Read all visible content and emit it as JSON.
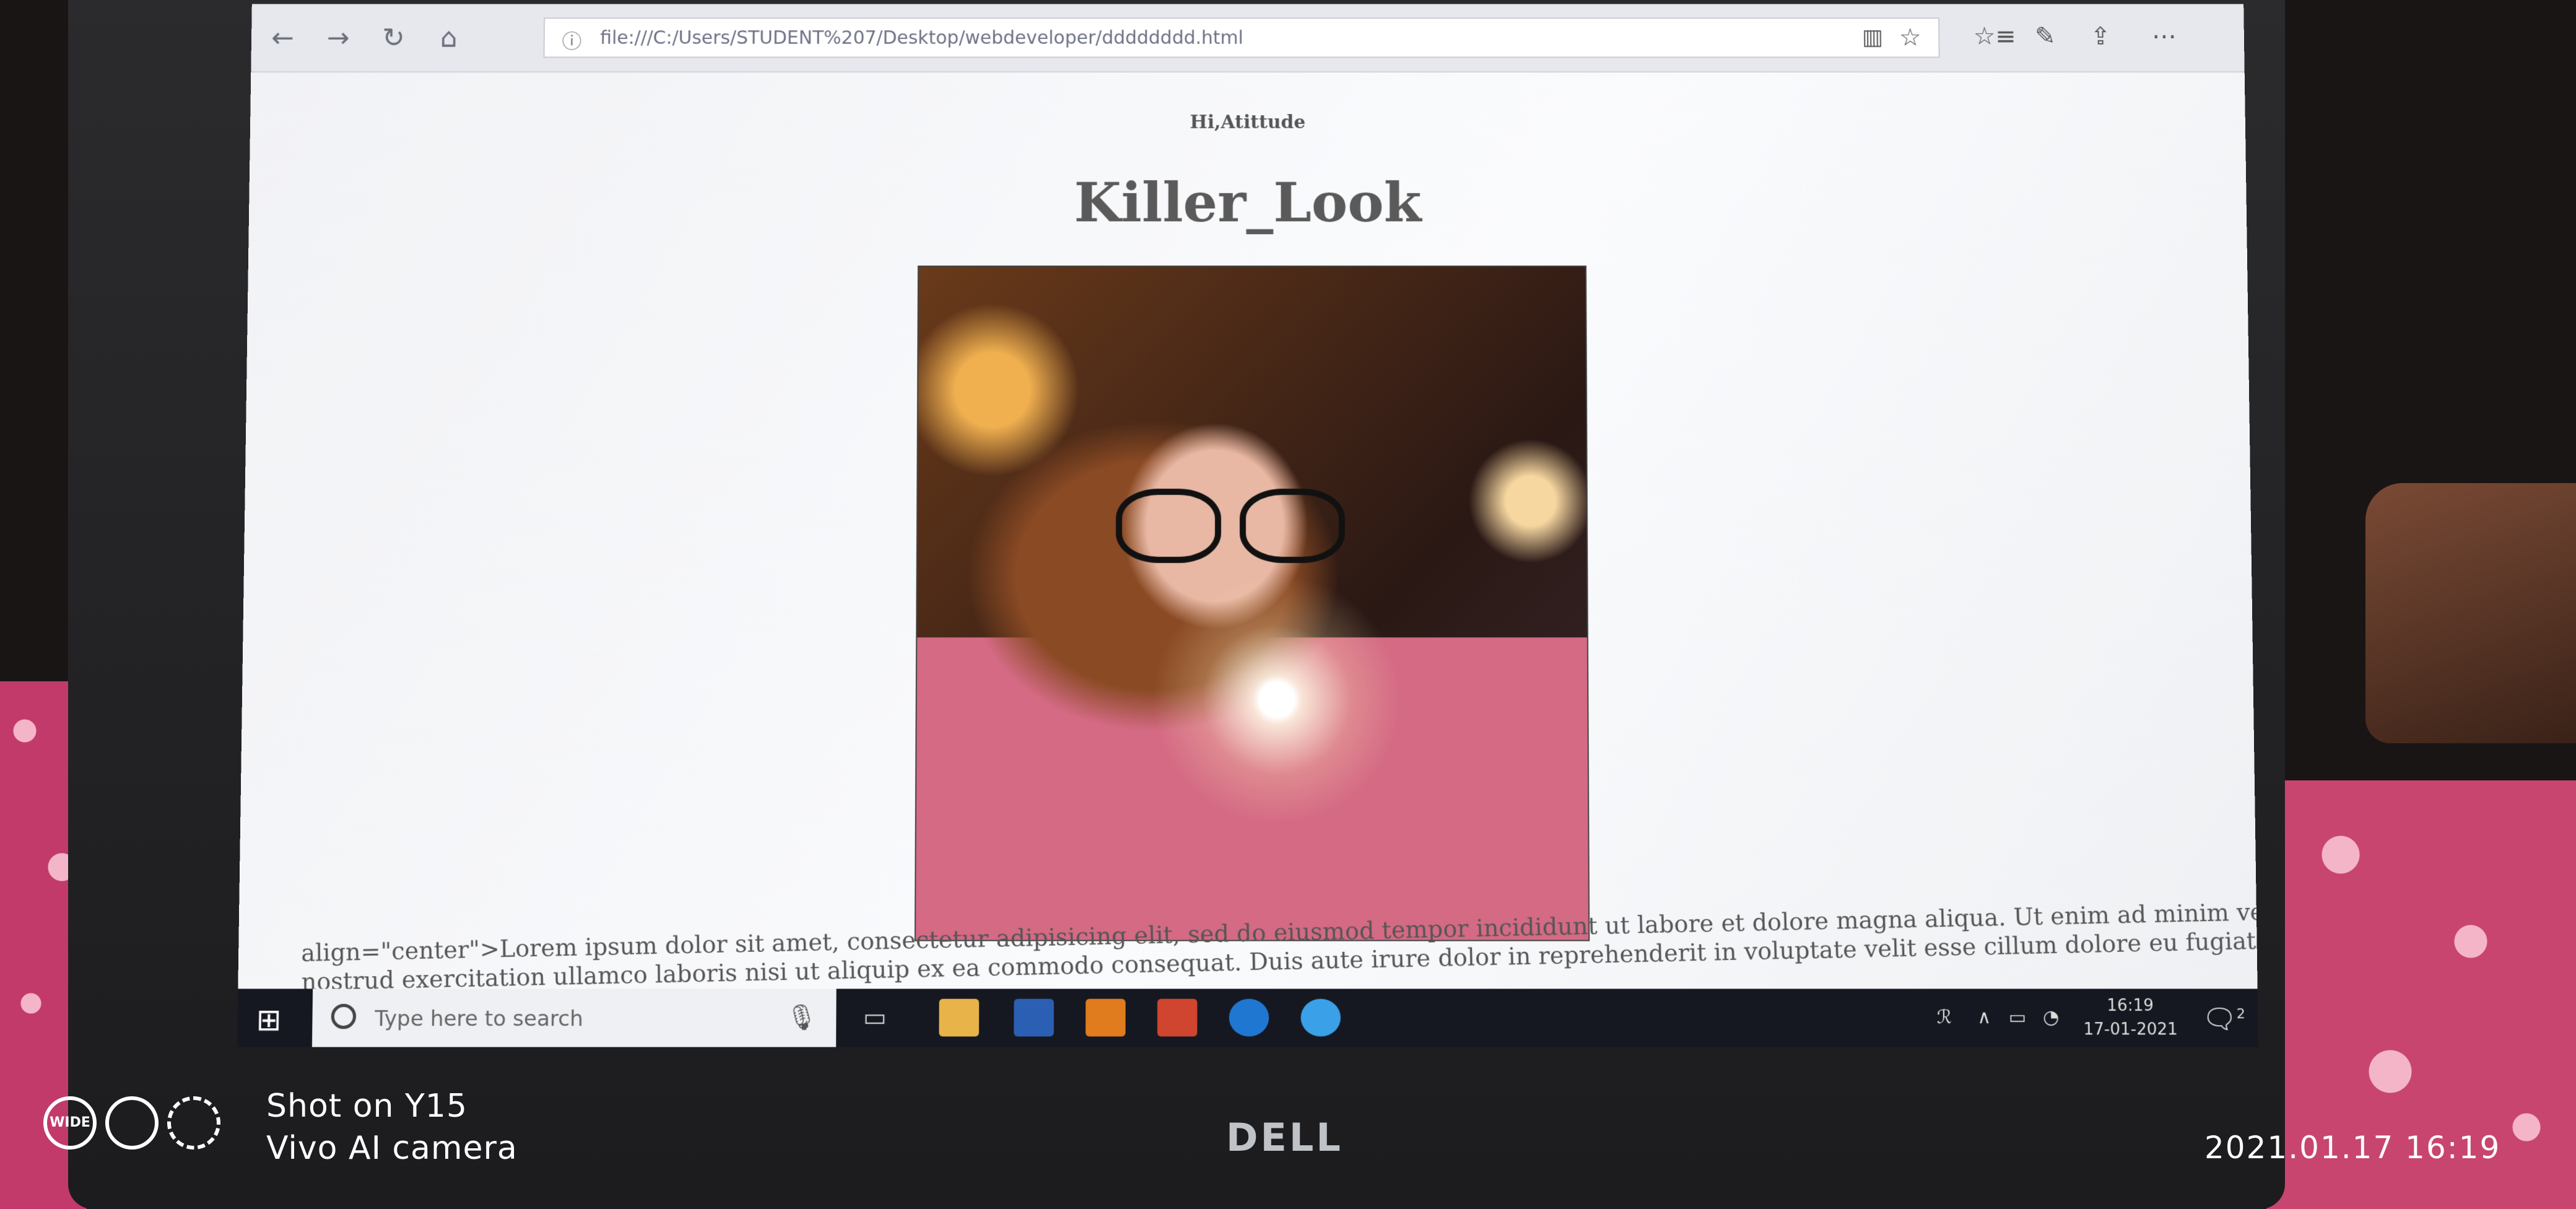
{
  "browser": {
    "url": "file:///C:/Users/STUDENT%207/Desktop/webdeveloper/dddddddd.html"
  },
  "page": {
    "small_heading": "Hi,Atittude",
    "main_heading": "Killer_Look",
    "body_line1": "align=\"center\">Lorem ipsum dolor sit amet, consectetur adipisicing elit, sed do eiusmod tempor incididunt ut labore et dolore magna aliqua. Ut enim ad minim veniam, quis",
    "body_line2": "nostrud exercitation ullamco laboris nisi ut aliquip ex ea commodo consequat. Duis aute irure dolor in reprehenderit in voluptate velit esse cillum dolore eu fugiat nulla pariatur."
  },
  "taskbar": {
    "search_placeholder": "Type here to search",
    "time": "16:19",
    "date": "17-01-2021",
    "notification_count": "2"
  },
  "laptop_brand": "DELL",
  "watermark": {
    "line1": "Shot on Y15",
    "line2": "Vivo AI camera",
    "wide_label": "WIDE",
    "timestamp": "2021.01.17 16:19"
  }
}
